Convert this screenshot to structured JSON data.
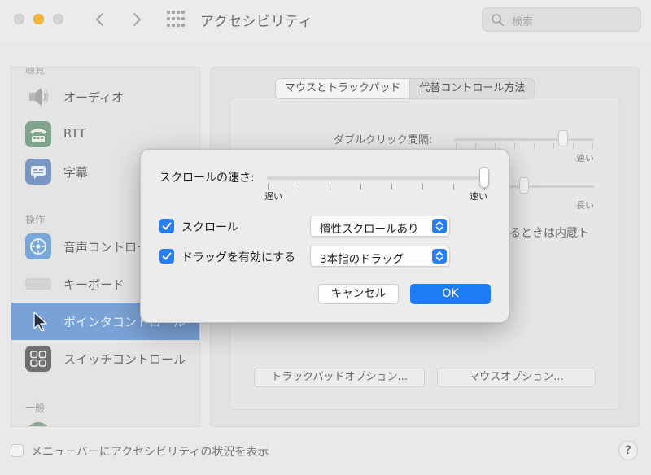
{
  "window": {
    "title": "アクセシビリティ",
    "search_placeholder": "検索"
  },
  "sidebar": {
    "sections": [
      {
        "label": "聴覚"
      },
      {
        "label": "操作"
      },
      {
        "label": "一般"
      }
    ],
    "items": [
      {
        "label": "オーディオ",
        "icon": "speaker-icon"
      },
      {
        "label": "RTT",
        "icon": "rtt-phone-icon"
      },
      {
        "label": "字幕",
        "icon": "captions-icon"
      },
      {
        "label": "音声コントロール",
        "icon": "voice-control-icon"
      },
      {
        "label": "キーボード",
        "icon": "keyboard-icon"
      },
      {
        "label": "ポインタコントロール",
        "icon": "pointer-icon",
        "selected": true
      },
      {
        "label": "スイッチコントロール",
        "icon": "switch-control-icon"
      }
    ]
  },
  "main": {
    "tabs": [
      {
        "label": "マウスとトラックパッド",
        "selected": true
      },
      {
        "label": "代替コントロール方法"
      }
    ],
    "double_click_label": "ダブルクリック間隔:",
    "double_click_max": "速い",
    "spring_max": "長い",
    "hidden_text": "るときは内蔵ト",
    "trackpad_options_button": "トラックパッドオプション...",
    "mouse_options_button": "マウスオプション..."
  },
  "footer": {
    "show_status_label": "メニューバーにアクセシビリティの状況を表示",
    "help_label": "?"
  },
  "dialog": {
    "scroll_speed_label": "スクロールの速さ:",
    "scroll_speed_min": "遅い",
    "scroll_speed_max": "速い",
    "scroll_speed_value": 1.0,
    "scroll_checkbox": {
      "label": "スクロール",
      "checked": true
    },
    "scroll_popup_value": "慣性スクロールあり",
    "drag_checkbox": {
      "label": "ドラッグを有効にする",
      "checked": true
    },
    "drag_popup_value": "3本指のドラッグ",
    "cancel_label": "キャンセル",
    "ok_label": "OK"
  },
  "colors": {
    "accent": "#1e7df4",
    "selected_sidebar_dimmed": "#7aa2d6",
    "traffic_yellow": "#f3b63c"
  }
}
